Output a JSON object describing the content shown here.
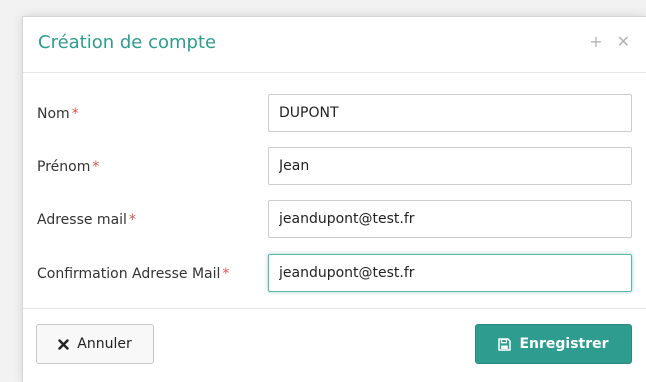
{
  "dialog": {
    "title": "Création de compte",
    "tools": {
      "expand_icon": "plus-icon",
      "close_icon": "close-icon"
    }
  },
  "form": {
    "required_marker": "*",
    "fields": [
      {
        "label": "Nom",
        "value": "DUPONT"
      },
      {
        "label": "Prénom",
        "value": "Jean"
      },
      {
        "label": "Adresse mail",
        "value": "jeandupont@test.fr"
      },
      {
        "label": "Confirmation Adresse Mail",
        "value": "jeandupont@test.fr"
      }
    ]
  },
  "footer": {
    "cancel_label": "Annuler",
    "cancel_icon": "times-icon",
    "save_label": "Enregistrer",
    "save_icon": "floppy-disk-icon"
  },
  "colors": {
    "accent": "#2e9c8f",
    "required": "#d9534f"
  }
}
